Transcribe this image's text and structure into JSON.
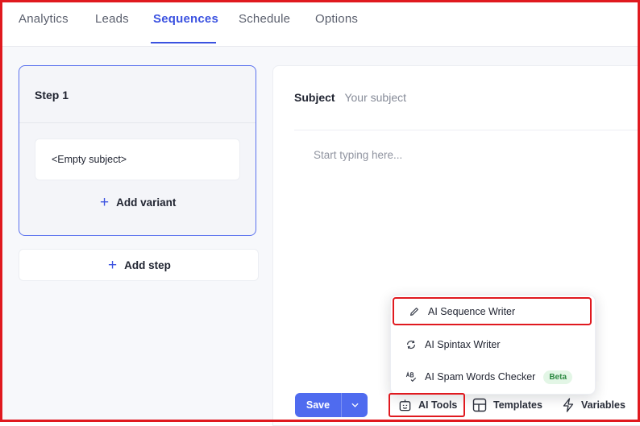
{
  "tabs": [
    {
      "label": "Analytics",
      "active": false
    },
    {
      "label": "Leads",
      "active": false
    },
    {
      "label": "Sequences",
      "active": true
    },
    {
      "label": "Schedule",
      "active": false
    },
    {
      "label": "Options",
      "active": false
    }
  ],
  "step": {
    "title": "Step 1",
    "variant_subject": "<Empty subject>",
    "add_variant_label": "Add variant"
  },
  "add_step_label": "Add step",
  "editor": {
    "subject_label": "Subject",
    "subject_placeholder": "Your subject",
    "body_placeholder": "Start typing here..."
  },
  "toolbar": {
    "save_label": "Save",
    "ai_tools_label": "AI Tools",
    "templates_label": "Templates",
    "variables_label": "Variables"
  },
  "ai_menu": {
    "items": [
      {
        "label": "AI Sequence Writer",
        "icon": "pencil-icon",
        "highlighted": true
      },
      {
        "label": "AI Spintax Writer",
        "icon": "refresh-icon"
      },
      {
        "label": "AI Spam Words Checker",
        "icon": "spellcheck-icon",
        "badge": "Beta"
      }
    ]
  },
  "colors": {
    "accent": "#3b52e0",
    "save_button": "#4f6bef",
    "highlight_border": "#e0191f",
    "beta_badge_bg": "#e3f6e6",
    "beta_badge_text": "#2e8a43"
  }
}
